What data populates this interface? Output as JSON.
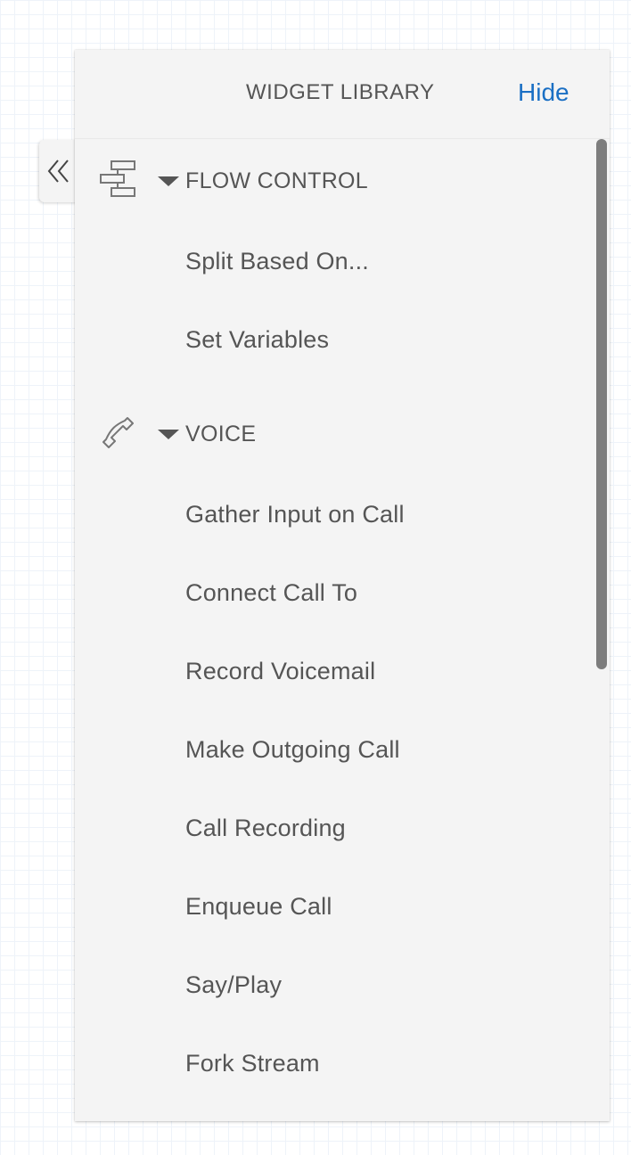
{
  "panel": {
    "title": "WIDGET LIBRARY",
    "hide_label": "Hide"
  },
  "sections": [
    {
      "label": "FLOW CONTROL",
      "icon": "flow-control-icon",
      "items": [
        {
          "label": "Split Based On..."
        },
        {
          "label": "Set Variables"
        }
      ]
    },
    {
      "label": "VOICE",
      "icon": "phone-icon",
      "items": [
        {
          "label": "Gather Input on Call"
        },
        {
          "label": "Connect Call To"
        },
        {
          "label": "Record Voicemail"
        },
        {
          "label": "Make Outgoing Call"
        },
        {
          "label": "Call Recording"
        },
        {
          "label": "Enqueue Call"
        },
        {
          "label": "Say/Play"
        },
        {
          "label": "Fork Stream"
        }
      ]
    }
  ],
  "colors": {
    "accent": "#1a6fc4",
    "text": "#555555",
    "panel_bg": "#f4f4f4",
    "scrollbar": "#7d7d7d"
  }
}
